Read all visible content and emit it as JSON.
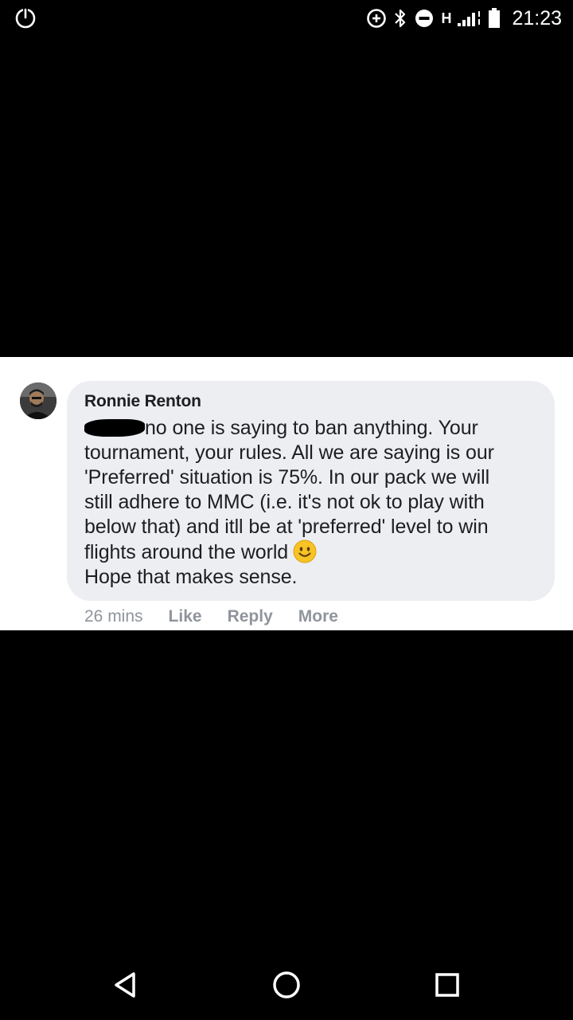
{
  "status_bar": {
    "time": "21:23",
    "network_label": "H",
    "icons": [
      "power-icon",
      "data-saver-icon",
      "bluetooth-icon",
      "do-not-disturb-icon",
      "signal-icon",
      "battery-icon"
    ]
  },
  "comment": {
    "author": "Ronnie Renton",
    "lines": [
      "no one is saying to ban anything. Your",
      "tournament, your rules. All we are saying is our",
      "'Preferred' situation is 75%. In our pack we will",
      "still adhere to MMC (i.e. it's not ok to play with",
      "below that) and itll be at 'preferred' level to win",
      "flights around the world",
      "Hope that makes sense."
    ],
    "emoji": "smiley-emoji-icon",
    "timestamp": "26 mins",
    "actions": {
      "like": "Like",
      "reply": "Reply",
      "more": "More"
    }
  },
  "colors": {
    "bubble": "#eceef2",
    "meta_text": "#90949c",
    "body_text": "#1c1e21",
    "background": "#000000"
  },
  "nav_bar": {
    "icons": [
      "back-icon",
      "home-icon",
      "recents-icon"
    ]
  }
}
